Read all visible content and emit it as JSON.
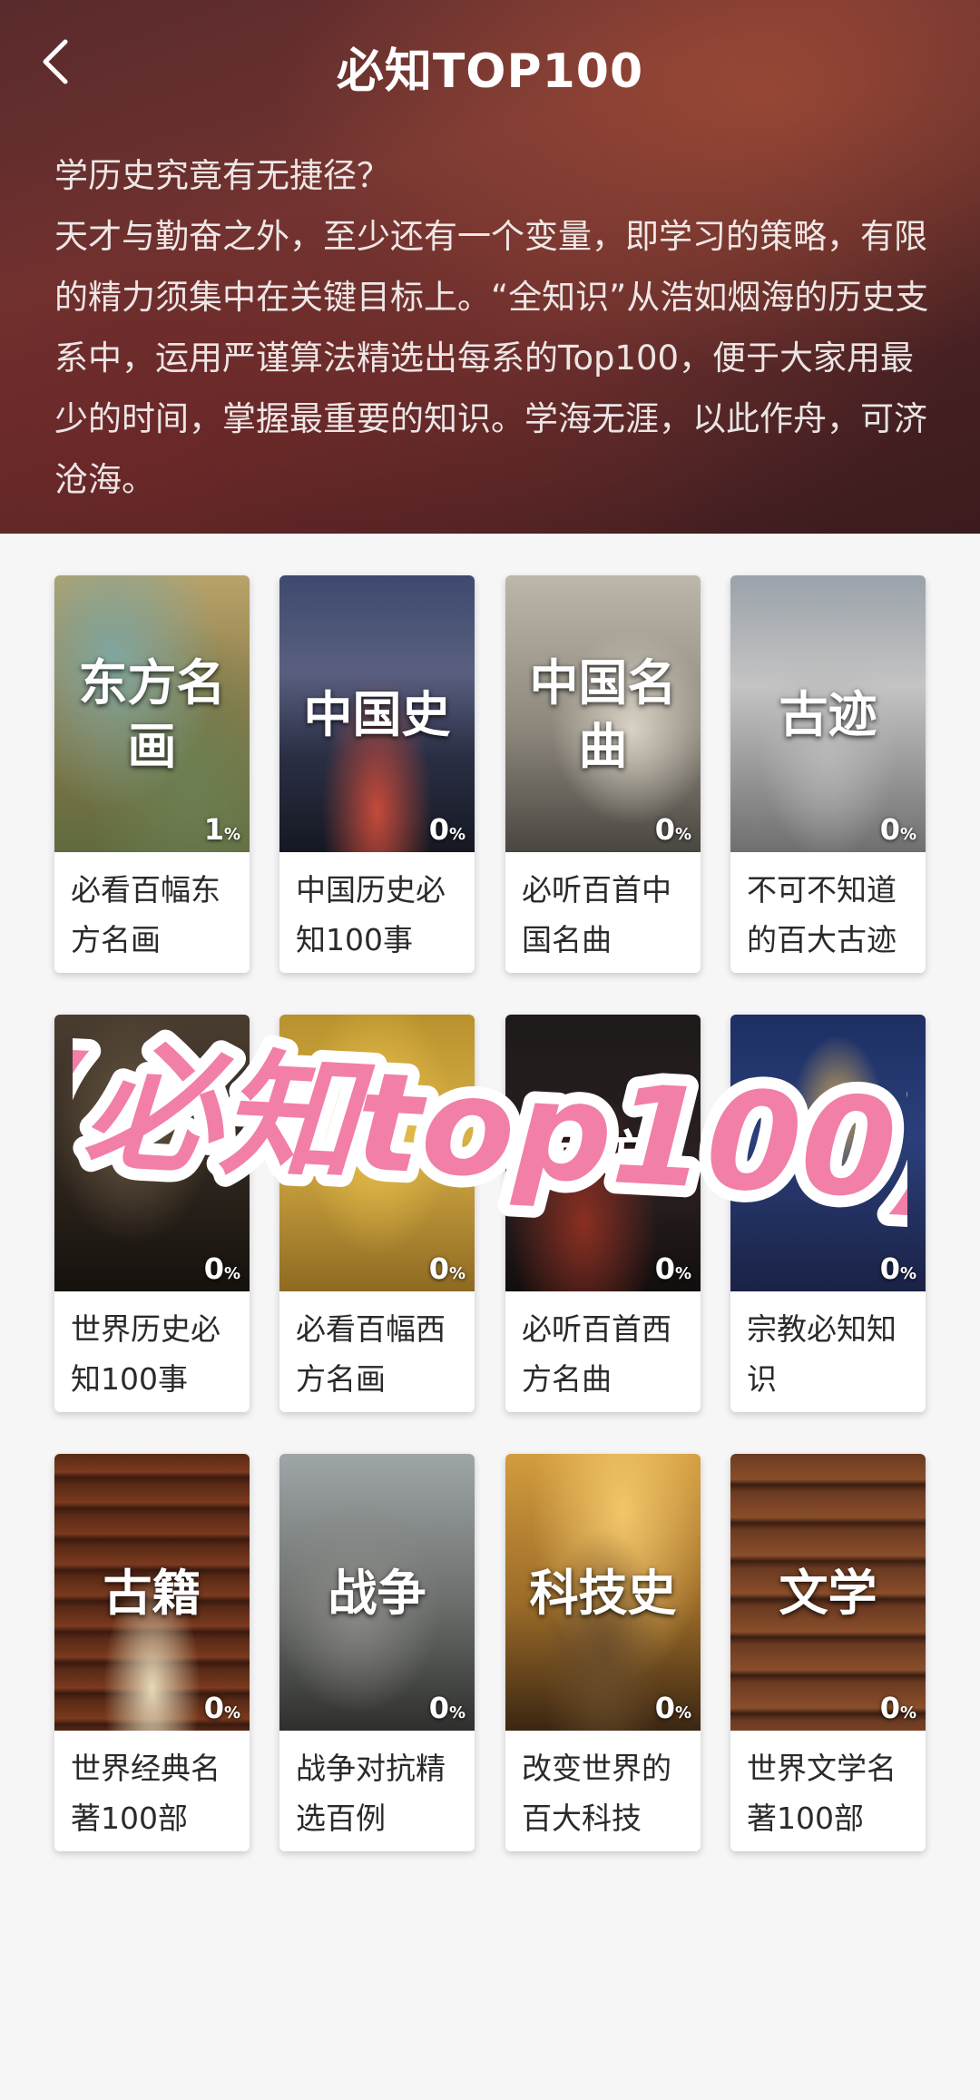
{
  "header": {
    "title": "必知TOP100",
    "intro": [
      "学历史究竟有无捷径？",
      "天才与勤奋之外，至少还有一个变量，即学习的策略，有限的精力须集中在关键目标上。“全知识”从浩如烟海的历史支系中，运用严谨算法精选出每系的Top100，便于大家用最少的时间，掌握最重要的知识。学海无涯，以此作舟，可济沧海。"
    ]
  },
  "cards": [
    {
      "thumb_title": "东方名画",
      "percent": "1",
      "label": "必看百幅东方名画"
    },
    {
      "thumb_title": "中国史",
      "percent": "0",
      "label": "中国历史必知100事"
    },
    {
      "thumb_title": "中国名曲",
      "percent": "0",
      "label": "必听百首中国名曲"
    },
    {
      "thumb_title": "古迹",
      "percent": "0",
      "label": "不可不知道的百大古迹"
    },
    {
      "thumb_title": "",
      "percent": "0",
      "label": "世界历史必知100事"
    },
    {
      "thumb_title": "",
      "percent": "0",
      "label": "必看百幅西方名画"
    },
    {
      "thumb_title": "西方",
      "percent": "0",
      "label": "必听百首西方名曲"
    },
    {
      "thumb_title": "",
      "percent": "0",
      "label": "宗教必知知识"
    },
    {
      "thumb_title": "古籍",
      "percent": "0",
      "label": "世界经典名著100部"
    },
    {
      "thumb_title": "战争",
      "percent": "0",
      "label": "战争对抗精选百例"
    },
    {
      "thumb_title": "科技史",
      "percent": "0",
      "label": "改变世界的百大科技"
    },
    {
      "thumb_title": "文学",
      "percent": "0",
      "label": "世界文学名著100部"
    }
  ],
  "percent_unit": "%",
  "overlay_text": "(必知top100)",
  "colors": {
    "overlay_pink": "#f27fa8",
    "header_bg": "#5a2a2c"
  }
}
